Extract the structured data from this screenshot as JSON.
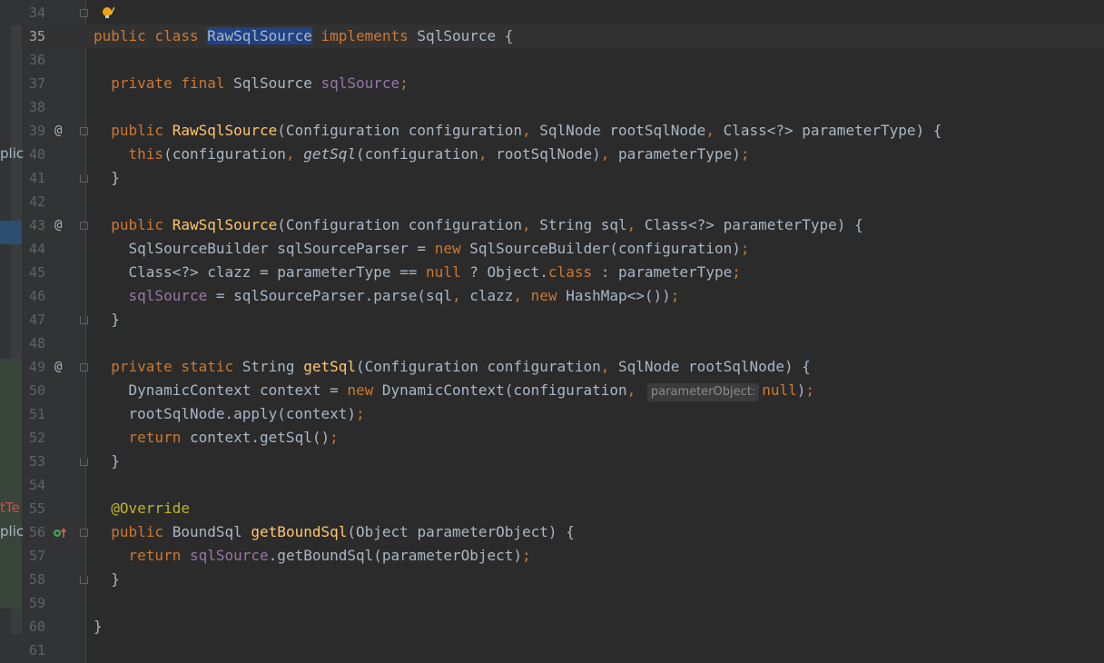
{
  "lines": [
    {
      "n": "34",
      "toks": []
    },
    {
      "n": "35",
      "toks": [
        [
          "kw",
          "public class "
        ],
        [
          "sel",
          "RawSqlSource"
        ],
        [
          "kw",
          " implements "
        ],
        [
          "",
          "SqlSource {"
        ]
      ]
    },
    {
      "n": "36",
      "toks": []
    },
    {
      "n": "37",
      "toks": [
        [
          "",
          "  "
        ],
        [
          "kw",
          "private final "
        ],
        [
          "",
          "SqlSource "
        ],
        [
          "fld",
          "sqlSource"
        ],
        [
          "kw",
          ";"
        ]
      ]
    },
    {
      "n": "38",
      "toks": []
    },
    {
      "n": "39",
      "toks": [
        [
          "",
          "  "
        ],
        [
          "kw",
          "public "
        ],
        [
          "fn",
          "RawSqlSource"
        ],
        [
          "",
          "(Configuration configuration"
        ],
        [
          "kw",
          ", "
        ],
        [
          "",
          "SqlNode rootSqlNode"
        ],
        [
          "kw",
          ", "
        ],
        [
          "",
          "Class<?> parameterType) {"
        ]
      ]
    },
    {
      "n": "40",
      "toks": [
        [
          "",
          "    "
        ],
        [
          "kw",
          "this"
        ],
        [
          "",
          "(configuration"
        ],
        [
          "kw",
          ", "
        ],
        [
          "it",
          "getSql"
        ],
        [
          "",
          "(configuration"
        ],
        [
          "kw",
          ", "
        ],
        [
          "",
          "rootSqlNode)"
        ],
        [
          "kw",
          ", "
        ],
        [
          "",
          "parameterType)"
        ],
        [
          "kw",
          ";"
        ]
      ]
    },
    {
      "n": "41",
      "toks": [
        [
          "",
          "  }"
        ]
      ]
    },
    {
      "n": "42",
      "toks": []
    },
    {
      "n": "43",
      "toks": [
        [
          "",
          "  "
        ],
        [
          "kw",
          "public "
        ],
        [
          "fn",
          "RawSqlSource"
        ],
        [
          "",
          "(Configuration configuration"
        ],
        [
          "kw",
          ", "
        ],
        [
          "",
          "String sql"
        ],
        [
          "kw",
          ", "
        ],
        [
          "",
          "Class<?> parameterType) {"
        ]
      ]
    },
    {
      "n": "44",
      "toks": [
        [
          "",
          "    SqlSourceBuilder sqlSourceParser = "
        ],
        [
          "kw",
          "new "
        ],
        [
          "",
          "SqlSourceBuilder(configuration)"
        ],
        [
          "kw",
          ";"
        ]
      ]
    },
    {
      "n": "45",
      "toks": [
        [
          "",
          "    Class<?> clazz = parameterType == "
        ],
        [
          "kw",
          "null "
        ],
        [
          "",
          "? Object."
        ],
        [
          "kw",
          "class "
        ],
        [
          "",
          ": parameterType"
        ],
        [
          "kw",
          ";"
        ]
      ]
    },
    {
      "n": "46",
      "toks": [
        [
          "",
          "    "
        ],
        [
          "fld",
          "sqlSource"
        ],
        [
          "",
          " = sqlSourceParser.parse(sql"
        ],
        [
          "kw",
          ", "
        ],
        [
          "",
          "clazz"
        ],
        [
          "kw",
          ", new "
        ],
        [
          "",
          "HashMap<>())"
        ],
        [
          "kw",
          ";"
        ]
      ]
    },
    {
      "n": "47",
      "toks": [
        [
          "",
          "  }"
        ]
      ]
    },
    {
      "n": "48",
      "toks": []
    },
    {
      "n": "49",
      "toks": [
        [
          "",
          "  "
        ],
        [
          "kw",
          "private static "
        ],
        [
          "",
          "String "
        ],
        [
          "fn",
          "getSql"
        ],
        [
          "",
          "(Configuration configuration"
        ],
        [
          "kw",
          ", "
        ],
        [
          "",
          "SqlNode rootSqlNode) {"
        ]
      ]
    },
    {
      "n": "50",
      "toks": [
        [
          "",
          "    DynamicContext context = "
        ],
        [
          "kw",
          "new "
        ],
        [
          "",
          "DynamicContext(configuration"
        ],
        [
          "kw",
          ", "
        ],
        [
          "hint",
          "parameterObject:"
        ],
        [
          "kw",
          "null"
        ],
        [
          "",
          ")"
        ],
        [
          "kw",
          ";"
        ]
      ]
    },
    {
      "n": "51",
      "toks": [
        [
          "",
          "    rootSqlNode.apply(context)"
        ],
        [
          "kw",
          ";"
        ]
      ]
    },
    {
      "n": "52",
      "toks": [
        [
          "",
          "    "
        ],
        [
          "kw",
          "return "
        ],
        [
          "",
          "context.getSql()"
        ],
        [
          "kw",
          ";"
        ]
      ]
    },
    {
      "n": "53",
      "toks": [
        [
          "",
          "  }"
        ]
      ]
    },
    {
      "n": "54",
      "toks": []
    },
    {
      "n": "55",
      "toks": [
        [
          "",
          "  "
        ],
        [
          "ann",
          "@Override"
        ]
      ]
    },
    {
      "n": "56",
      "toks": [
        [
          "",
          "  "
        ],
        [
          "kw",
          "public "
        ],
        [
          "",
          "BoundSql "
        ],
        [
          "fn",
          "getBoundSql"
        ],
        [
          "",
          "(Object parameterObject) {"
        ]
      ]
    },
    {
      "n": "57",
      "toks": [
        [
          "",
          "    "
        ],
        [
          "kw",
          "return "
        ],
        [
          "fld",
          "sqlSource"
        ],
        [
          "",
          ".getBoundSql(parameterObject)"
        ],
        [
          "kw",
          ";"
        ]
      ]
    },
    {
      "n": "58",
      "toks": [
        [
          "",
          "  }"
        ]
      ]
    },
    {
      "n": "59",
      "toks": []
    },
    {
      "n": "60",
      "toks": [
        [
          "",
          "}"
        ]
      ]
    },
    {
      "n": "61",
      "toks": []
    }
  ],
  "markers": {
    "39": "@",
    "43": "@",
    "49": "@"
  },
  "left_fragments": [
    {
      "text": "plic",
      "line": "40",
      "tone": "normal"
    },
    {
      "text": "tTe",
      "line": "55",
      "tone": "red"
    },
    {
      "text": "plic",
      "line": "56",
      "tone": "normal"
    }
  ],
  "icons": {
    "bulb_line": "34",
    "bulb": "intention-bulb-icon",
    "override_line": "56",
    "override": "implements-method-icon"
  },
  "active_line": "35",
  "colors": {
    "keyword": "#cc7832",
    "function": "#ffc66d",
    "field": "#9876aa",
    "annotation": "#bbb529",
    "text": "#a9b7c6",
    "selection": "#214283"
  }
}
